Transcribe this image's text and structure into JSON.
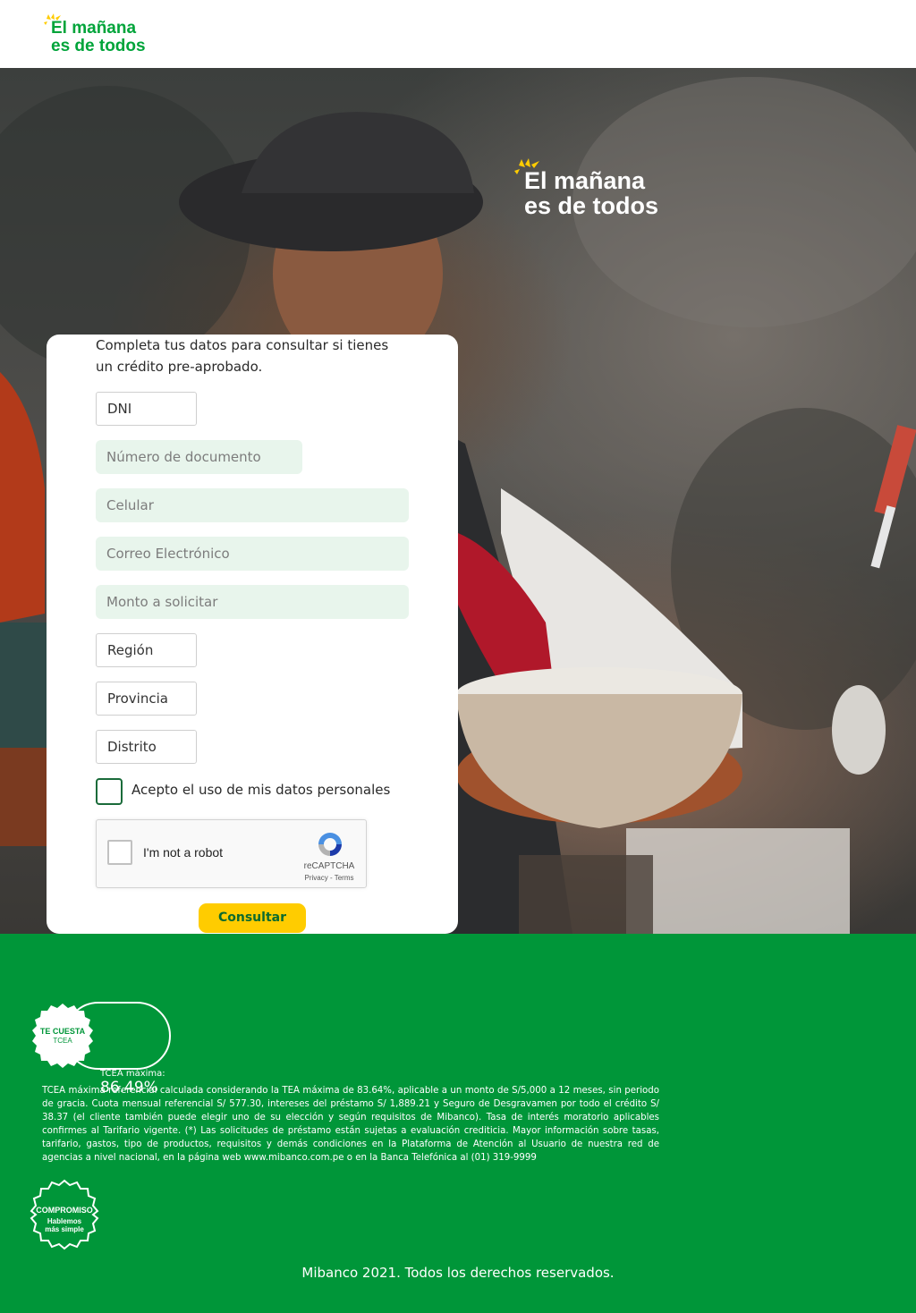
{
  "header": {
    "logo_line1": "El mañana",
    "logo_line2": "es de todos"
  },
  "hero": {
    "logo_line1": "El mañana",
    "logo_line2": "es de todos"
  },
  "form": {
    "intro": "Completa tus datos para consultar si tienes un crédito pre-aprobado.",
    "document_type": "DNI",
    "document_number_placeholder": "Número de documento",
    "phone_placeholder": "Celular",
    "email_placeholder": "Correo Electrónico",
    "amount_placeholder": "Monto a solicitar",
    "region": "Región",
    "province": "Provincia",
    "district": "Distrito",
    "consent_label": "Acepto el uso de mis datos personales",
    "consent_checked": false,
    "recaptcha": {
      "label": "I'm not a robot",
      "brand": "reCAPTCHA",
      "links": "Privacy - Terms"
    },
    "submit_label": "Consultar"
  },
  "footer": {
    "badge_title": "TE CUESTA",
    "badge_subtitle": "TCEA",
    "tcea_label": "TCEA máxima:",
    "tcea_value": "86.49%",
    "legal": "TCEA máxima referencial calculada considerando la TEA máxima de 83.64%, aplicable a un monto de S/5,000 a 12 meses, sin periodo de gracia. Cuota mensual referencial S/ 577.30, intereses del préstamo S/ 1,889.21 y Seguro de Desgravamen por todo el crédito S/ 38.37 (el cliente también puede elegir uno de su elección y según requisitos de Mibanco). Tasa de interés moratorio aplicables confirmes al Tarifario vigente. (*) Las solicitudes de préstamo están sujetas a evaluación crediticia. Mayor información sobre tasas, tarifario, gastos, tipo de productos, requisitos y demás condiciones en la Plataforma de Atención al Usuario de nuestra red de agencias a nivel nacional, en la página web www.mibanco.com.pe o en la Banca Telefónica al (01) 319-9999",
    "commitment_title": "COMPROMISO",
    "commitment_line1": "Hablemos",
    "commitment_line2": "más simple",
    "copyright": "Mibanco 2021. Todos los derechos reservados."
  },
  "colors": {
    "brand_green": "#009639",
    "logo_green": "#00a43a",
    "accent_yellow": "#ffcc00",
    "input_bg": "#e8f5ec"
  }
}
